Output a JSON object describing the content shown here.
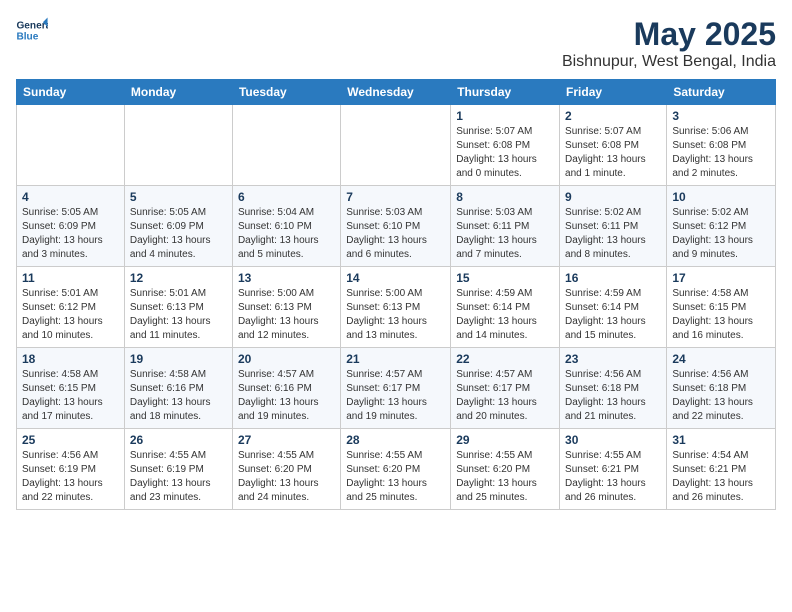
{
  "header": {
    "logo_line1": "General",
    "logo_line2": "Blue",
    "title": "May 2025",
    "subtitle": "Bishnupur, West Bengal, India"
  },
  "weekdays": [
    "Sunday",
    "Monday",
    "Tuesday",
    "Wednesday",
    "Thursday",
    "Friday",
    "Saturday"
  ],
  "weeks": [
    [
      {
        "num": "",
        "info": ""
      },
      {
        "num": "",
        "info": ""
      },
      {
        "num": "",
        "info": ""
      },
      {
        "num": "",
        "info": ""
      },
      {
        "num": "1",
        "info": "Sunrise: 5:07 AM\nSunset: 6:08 PM\nDaylight: 13 hours and 0 minutes."
      },
      {
        "num": "2",
        "info": "Sunrise: 5:07 AM\nSunset: 6:08 PM\nDaylight: 13 hours and 1 minute."
      },
      {
        "num": "3",
        "info": "Sunrise: 5:06 AM\nSunset: 6:08 PM\nDaylight: 13 hours and 2 minutes."
      }
    ],
    [
      {
        "num": "4",
        "info": "Sunrise: 5:05 AM\nSunset: 6:09 PM\nDaylight: 13 hours and 3 minutes."
      },
      {
        "num": "5",
        "info": "Sunrise: 5:05 AM\nSunset: 6:09 PM\nDaylight: 13 hours and 4 minutes."
      },
      {
        "num": "6",
        "info": "Sunrise: 5:04 AM\nSunset: 6:10 PM\nDaylight: 13 hours and 5 minutes."
      },
      {
        "num": "7",
        "info": "Sunrise: 5:03 AM\nSunset: 6:10 PM\nDaylight: 13 hours and 6 minutes."
      },
      {
        "num": "8",
        "info": "Sunrise: 5:03 AM\nSunset: 6:11 PM\nDaylight: 13 hours and 7 minutes."
      },
      {
        "num": "9",
        "info": "Sunrise: 5:02 AM\nSunset: 6:11 PM\nDaylight: 13 hours and 8 minutes."
      },
      {
        "num": "10",
        "info": "Sunrise: 5:02 AM\nSunset: 6:12 PM\nDaylight: 13 hours and 9 minutes."
      }
    ],
    [
      {
        "num": "11",
        "info": "Sunrise: 5:01 AM\nSunset: 6:12 PM\nDaylight: 13 hours and 10 minutes."
      },
      {
        "num": "12",
        "info": "Sunrise: 5:01 AM\nSunset: 6:13 PM\nDaylight: 13 hours and 11 minutes."
      },
      {
        "num": "13",
        "info": "Sunrise: 5:00 AM\nSunset: 6:13 PM\nDaylight: 13 hours and 12 minutes."
      },
      {
        "num": "14",
        "info": "Sunrise: 5:00 AM\nSunset: 6:13 PM\nDaylight: 13 hours and 13 minutes."
      },
      {
        "num": "15",
        "info": "Sunrise: 4:59 AM\nSunset: 6:14 PM\nDaylight: 13 hours and 14 minutes."
      },
      {
        "num": "16",
        "info": "Sunrise: 4:59 AM\nSunset: 6:14 PM\nDaylight: 13 hours and 15 minutes."
      },
      {
        "num": "17",
        "info": "Sunrise: 4:58 AM\nSunset: 6:15 PM\nDaylight: 13 hours and 16 minutes."
      }
    ],
    [
      {
        "num": "18",
        "info": "Sunrise: 4:58 AM\nSunset: 6:15 PM\nDaylight: 13 hours and 17 minutes."
      },
      {
        "num": "19",
        "info": "Sunrise: 4:58 AM\nSunset: 6:16 PM\nDaylight: 13 hours and 18 minutes."
      },
      {
        "num": "20",
        "info": "Sunrise: 4:57 AM\nSunset: 6:16 PM\nDaylight: 13 hours and 19 minutes."
      },
      {
        "num": "21",
        "info": "Sunrise: 4:57 AM\nSunset: 6:17 PM\nDaylight: 13 hours and 19 minutes."
      },
      {
        "num": "22",
        "info": "Sunrise: 4:57 AM\nSunset: 6:17 PM\nDaylight: 13 hours and 20 minutes."
      },
      {
        "num": "23",
        "info": "Sunrise: 4:56 AM\nSunset: 6:18 PM\nDaylight: 13 hours and 21 minutes."
      },
      {
        "num": "24",
        "info": "Sunrise: 4:56 AM\nSunset: 6:18 PM\nDaylight: 13 hours and 22 minutes."
      }
    ],
    [
      {
        "num": "25",
        "info": "Sunrise: 4:56 AM\nSunset: 6:19 PM\nDaylight: 13 hours and 22 minutes."
      },
      {
        "num": "26",
        "info": "Sunrise: 4:55 AM\nSunset: 6:19 PM\nDaylight: 13 hours and 23 minutes."
      },
      {
        "num": "27",
        "info": "Sunrise: 4:55 AM\nSunset: 6:20 PM\nDaylight: 13 hours and 24 minutes."
      },
      {
        "num": "28",
        "info": "Sunrise: 4:55 AM\nSunset: 6:20 PM\nDaylight: 13 hours and 25 minutes."
      },
      {
        "num": "29",
        "info": "Sunrise: 4:55 AM\nSunset: 6:20 PM\nDaylight: 13 hours and 25 minutes."
      },
      {
        "num": "30",
        "info": "Sunrise: 4:55 AM\nSunset: 6:21 PM\nDaylight: 13 hours and 26 minutes."
      },
      {
        "num": "31",
        "info": "Sunrise: 4:54 AM\nSunset: 6:21 PM\nDaylight: 13 hours and 26 minutes."
      }
    ]
  ]
}
